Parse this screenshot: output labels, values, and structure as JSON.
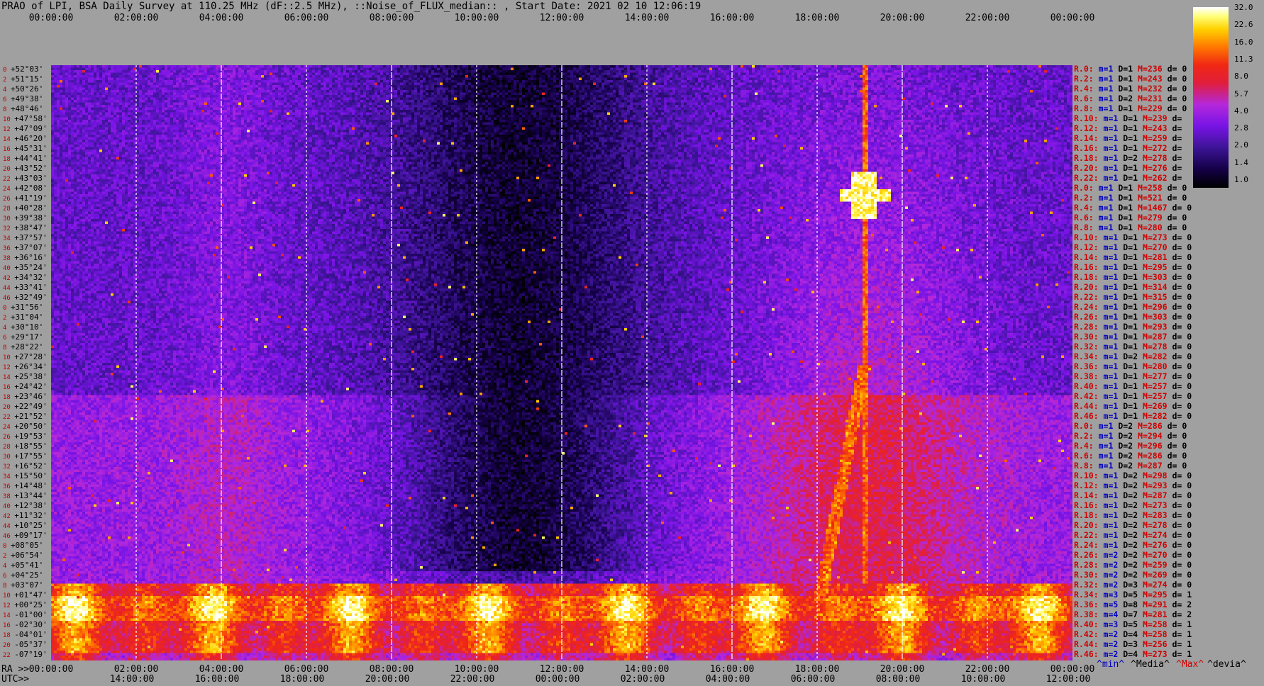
{
  "title": "PRAO of LPI, BSA Daily Survey at 110.25 MHz (dF::2.5 MHz), ::Noise_of_FLUX_median:: , Start Date: 2021 02 10 12:06:19",
  "top_axis_ticks": [
    "00:00:00",
    "02:00:00",
    "04:00:00",
    "06:00:00",
    "08:00:00",
    "10:00:00",
    "12:00:00",
    "14:00:00",
    "16:00:00",
    "18:00:00",
    "20:00:00",
    "22:00:00",
    "00:00:00"
  ],
  "bottom_axis": {
    "ra_label": "RA >>",
    "utc_label": "UTC>>",
    "ra_ticks": [
      "00:00:00",
      "02:00:00",
      "04:00:00",
      "06:00:00",
      "08:00:00",
      "10:00:00",
      "12:00:00",
      "14:00:00",
      "16:00:00",
      "18:00:00",
      "20:00:00",
      "22:00:00",
      "00:00:00"
    ],
    "utc_ticks": [
      "14:00:00",
      "16:00:00",
      "18:00:00",
      "20:00:00",
      "22:00:00",
      "00:00:00",
      "02:00:00",
      "04:00:00",
      "06:00:00",
      "08:00:00",
      "10:00:00",
      "12:00:00"
    ]
  },
  "colorbar": {
    "ticks": [
      "32.0",
      "22.6",
      "16.0",
      "11.3",
      "8.0",
      "5.7",
      "4.0",
      "2.8",
      "2.0",
      "1.4",
      "1.0"
    ],
    "colors": [
      "#000000",
      "#1a0060",
      "#4020b0",
      "#8a20e0",
      "#c030d0",
      "#e02020",
      "#ff7000",
      "#ffc000",
      "#ffff60",
      "#ffffff"
    ]
  },
  "legend": {
    "min": "^min^",
    "median": "^Media^",
    "max": "^Max^",
    "devia": "^devia^"
  },
  "chart_data": {
    "type": "heatmap",
    "title": "PRAO of LPI, BSA Daily Survey at 110.25 MHz (dF::2.5 MHz), ::Noise_of_FLUX_median:: , Start Date: 2021 02 10 12:06:19",
    "xlabel": "RA / UTC",
    "x_range_ra": [
      "00:00:00",
      "24:00:00"
    ],
    "color_scale": "log",
    "color_range": [
      1.0,
      32.0
    ],
    "declinations": [
      "+52°03'",
      "+51°15'",
      "+50°26'",
      "+49°38'",
      "+48°46'",
      "+47°58'",
      "+47°09'",
      "+46°20'",
      "+45°31'",
      "+44°41'",
      "+43°52'",
      "+43°03'",
      "+42°08'",
      "+41°19'",
      "+40°28'",
      "+39°38'",
      "+38°47'",
      "+37°57'",
      "+37°07'",
      "+36°16'",
      "+35°24'",
      "+34°32'",
      "+33°41'",
      "+32°49'",
      "+31°56'",
      "+31°04'",
      "+30°10'",
      "+29°17'",
      "+28°22'",
      "+27°28'",
      "+26°34'",
      "+25°38'",
      "+24°42'",
      "+23°46'",
      "+22°49'",
      "+21°52'",
      "+20°50'",
      "+19°53'",
      "+18°55'",
      "+17°55'",
      "+16°52'",
      "+15°50'",
      "+14°48'",
      "+13°44'",
      "+12°38'",
      "+11°32'",
      "+10°25'",
      "+09°17'",
      "+08°05'",
      "+06°54'",
      "+05°41'",
      "+04°25'",
      "+03°07'",
      "+01°47'",
      "+00°25'",
      "-01°00'",
      "-02°30'",
      "-04°01'",
      "-05°37'",
      "-07°19'"
    ],
    "beam_index": [
      "0",
      "2",
      "4",
      "6",
      "8",
      "10",
      "12",
      "14",
      "16",
      "18",
      "20",
      "22",
      "24",
      "26",
      "28",
      "30",
      "32",
      "34",
      "36",
      "38",
      "40",
      "42",
      "44",
      "46",
      "0",
      "2",
      "4",
      "6",
      "8",
      "10",
      "12",
      "14",
      "16",
      "18",
      "20",
      "22",
      "24",
      "26",
      "28",
      "30",
      "32",
      "34",
      "36",
      "38",
      "40",
      "42",
      "44",
      "46",
      "0",
      "2",
      "4",
      "6",
      "8",
      "10",
      "12",
      "14",
      "16",
      "18",
      "20",
      "22"
    ],
    "row_stats": [
      {
        "r": "R.0:",
        "min": "m=1",
        "d": "D=1",
        "max": "M=236",
        "dev": "d= 0"
      },
      {
        "r": "R.2:",
        "min": "m=1",
        "d": "D=1",
        "max": "M=243",
        "dev": "d= 0"
      },
      {
        "r": "R.4:",
        "min": "m=1",
        "d": "D=1",
        "max": "M=232",
        "dev": "d= 0"
      },
      {
        "r": "R.6:",
        "min": "m=1",
        "d": "D=2",
        "max": "M=231",
        "dev": "d= 0"
      },
      {
        "r": "R.8:",
        "min": "m=1",
        "d": "D=1",
        "max": "M=229",
        "dev": "d= 0"
      },
      {
        "r": "R.10:",
        "min": "m=1",
        "d": "D=1",
        "max": "M=239",
        "dev": "d="
      },
      {
        "r": "R.12:",
        "min": "m=1",
        "d": "D=1",
        "max": "M=243",
        "dev": "d="
      },
      {
        "r": "R.14:",
        "min": "m=1",
        "d": "D=1",
        "max": "M=259",
        "dev": "d="
      },
      {
        "r": "R.16:",
        "min": "m=1",
        "d": "D=1",
        "max": "M=272",
        "dev": "d="
      },
      {
        "r": "R.18:",
        "min": "m=1",
        "d": "D=2",
        "max": "M=278",
        "dev": "d="
      },
      {
        "r": "R.20:",
        "min": "m=1",
        "d": "D=1",
        "max": "M=276",
        "dev": "d="
      },
      {
        "r": "R.22:",
        "min": "m=1",
        "d": "D=1",
        "max": "M=262",
        "dev": "d="
      },
      {
        "r": "R.0:",
        "min": "m=1",
        "d": "D=1",
        "max": "M=258",
        "dev": "d= 0"
      },
      {
        "r": "R.2:",
        "min": "m=1",
        "d": "D=1",
        "max": "M=521",
        "dev": "d= 0"
      },
      {
        "r": "R.4:",
        "min": "m=1",
        "d": "D=1",
        "max": "M=1467",
        "dev": "d= 0"
      },
      {
        "r": "R.6:",
        "min": "m=1",
        "d": "D=1",
        "max": "M=279",
        "dev": "d= 0"
      },
      {
        "r": "R.8:",
        "min": "m=1",
        "d": "D=1",
        "max": "M=280",
        "dev": "d= 0"
      },
      {
        "r": "R.10:",
        "min": "m=1",
        "d": "D=1",
        "max": "M=273",
        "dev": "d= 0"
      },
      {
        "r": "R.12:",
        "min": "m=1",
        "d": "D=1",
        "max": "M=270",
        "dev": "d= 0"
      },
      {
        "r": "R.14:",
        "min": "m=1",
        "d": "D=1",
        "max": "M=281",
        "dev": "d= 0"
      },
      {
        "r": "R.16:",
        "min": "m=1",
        "d": "D=1",
        "max": "M=295",
        "dev": "d= 0"
      },
      {
        "r": "R.18:",
        "min": "m=1",
        "d": "D=1",
        "max": "M=303",
        "dev": "d= 0"
      },
      {
        "r": "R.20:",
        "min": "m=1",
        "d": "D=1",
        "max": "M=314",
        "dev": "d= 0"
      },
      {
        "r": "R.22:",
        "min": "m=1",
        "d": "D=1",
        "max": "M=315",
        "dev": "d= 0"
      },
      {
        "r": "R.24:",
        "min": "m=1",
        "d": "D=1",
        "max": "M=296",
        "dev": "d= 0"
      },
      {
        "r": "R.26:",
        "min": "m=1",
        "d": "D=1",
        "max": "M=303",
        "dev": "d= 0"
      },
      {
        "r": "R.28:",
        "min": "m=1",
        "d": "D=1",
        "max": "M=293",
        "dev": "d= 0"
      },
      {
        "r": "R.30:",
        "min": "m=1",
        "d": "D=1",
        "max": "M=287",
        "dev": "d= 0"
      },
      {
        "r": "R.32:",
        "min": "m=1",
        "d": "D=1",
        "max": "M=278",
        "dev": "d= 0"
      },
      {
        "r": "R.34:",
        "min": "m=1",
        "d": "D=2",
        "max": "M=282",
        "dev": "d= 0"
      },
      {
        "r": "R.36:",
        "min": "m=1",
        "d": "D=1",
        "max": "M=280",
        "dev": "d= 0"
      },
      {
        "r": "R.38:",
        "min": "m=1",
        "d": "D=1",
        "max": "M=277",
        "dev": "d= 0"
      },
      {
        "r": "R.40:",
        "min": "m=1",
        "d": "D=1",
        "max": "M=257",
        "dev": "d= 0"
      },
      {
        "r": "R.42:",
        "min": "m=1",
        "d": "D=1",
        "max": "M=257",
        "dev": "d= 0"
      },
      {
        "r": "R.44:",
        "min": "m=1",
        "d": "D=1",
        "max": "M=269",
        "dev": "d= 0"
      },
      {
        "r": "R.46:",
        "min": "m=1",
        "d": "D=1",
        "max": "M=282",
        "dev": "d= 0"
      },
      {
        "r": "R.0:",
        "min": "m=1",
        "d": "D=2",
        "max": "M=286",
        "dev": "d= 0"
      },
      {
        "r": "R.2:",
        "min": "m=1",
        "d": "D=2",
        "max": "M=294",
        "dev": "d= 0"
      },
      {
        "r": "R.4:",
        "min": "m=1",
        "d": "D=2",
        "max": "M=296",
        "dev": "d= 0"
      },
      {
        "r": "R.6:",
        "min": "m=1",
        "d": "D=2",
        "max": "M=286",
        "dev": "d= 0"
      },
      {
        "r": "R.8:",
        "min": "m=1",
        "d": "D=2",
        "max": "M=287",
        "dev": "d= 0"
      },
      {
        "r": "R.10:",
        "min": "m=1",
        "d": "D=2",
        "max": "M=298",
        "dev": "d= 0"
      },
      {
        "r": "R.12:",
        "min": "m=1",
        "d": "D=2",
        "max": "M=293",
        "dev": "d= 0"
      },
      {
        "r": "R.14:",
        "min": "m=1",
        "d": "D=2",
        "max": "M=287",
        "dev": "d= 0"
      },
      {
        "r": "R.16:",
        "min": "m=1",
        "d": "D=2",
        "max": "M=273",
        "dev": "d= 0"
      },
      {
        "r": "R.18:",
        "min": "m=1",
        "d": "D=2",
        "max": "M=283",
        "dev": "d= 0"
      },
      {
        "r": "R.20:",
        "min": "m=1",
        "d": "D=2",
        "max": "M=278",
        "dev": "d= 0"
      },
      {
        "r": "R.22:",
        "min": "m=1",
        "d": "D=2",
        "max": "M=274",
        "dev": "d= 0"
      },
      {
        "r": "R.24:",
        "min": "m=1",
        "d": "D=2",
        "max": "M=276",
        "dev": "d= 0"
      },
      {
        "r": "R.26:",
        "min": "m=2",
        "d": "D=2",
        "max": "M=270",
        "dev": "d= 0"
      },
      {
        "r": "R.28:",
        "min": "m=2",
        "d": "D=2",
        "max": "M=259",
        "dev": "d= 0"
      },
      {
        "r": "R.30:",
        "min": "m=2",
        "d": "D=2",
        "max": "M=269",
        "dev": "d= 0"
      },
      {
        "r": "R.32:",
        "min": "m=2",
        "d": "D=3",
        "max": "M=274",
        "dev": "d= 0"
      },
      {
        "r": "R.34:",
        "min": "m=3",
        "d": "D=5",
        "max": "M=295",
        "dev": "d= 1"
      },
      {
        "r": "R.36:",
        "min": "m=5",
        "d": "D=8",
        "max": "M=291",
        "dev": "d= 2"
      },
      {
        "r": "R.38:",
        "min": "m=4",
        "d": "D=7",
        "max": "M=281",
        "dev": "d= 2"
      },
      {
        "r": "R.40:",
        "min": "m=3",
        "d": "D=5",
        "max": "M=258",
        "dev": "d= 1"
      },
      {
        "r": "R.42:",
        "min": "m=2",
        "d": "D=4",
        "max": "M=258",
        "dev": "d= 1"
      },
      {
        "r": "R.44:",
        "min": "m=2",
        "d": "D=3",
        "max": "M=256",
        "dev": "d= 1"
      },
      {
        "r": "R.46:",
        "min": "m=2",
        "d": "D=4",
        "max": "M=273",
        "dev": "d= 1"
      }
    ],
    "features": {
      "galactic_plane_band": {
        "dec_from": "+01°47'",
        "dec_to": "-07°19'",
        "level": "8.0-32.0"
      },
      "bright_source": {
        "ra": "20:00:00",
        "dec": "+41°19'",
        "level": "32.0"
      },
      "quiet_region_ra": [
        "08:00:00",
        "14:00:00"
      ]
    }
  }
}
